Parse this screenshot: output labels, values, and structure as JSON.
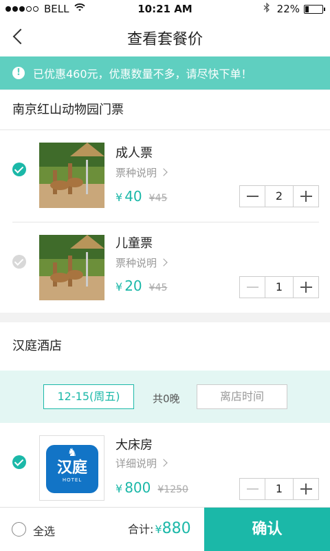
{
  "status_bar": {
    "carrier": "BELL",
    "time": "10:21 AM",
    "battery": "22%"
  },
  "nav": {
    "title": "查看套餐价"
  },
  "notice": {
    "text": "已优惠460元，优惠数量不多，请尽快下单！"
  },
  "ticket_section": {
    "title": "南京红山动物园门票",
    "items": [
      {
        "name": "成人票",
        "desc": "票种说明",
        "currency": "¥",
        "price": "40",
        "old_price": "¥45",
        "qty": "2",
        "checked": true
      },
      {
        "name": "儿童票",
        "desc": "票种说明",
        "currency": "¥",
        "price": "20",
        "old_price": "¥45",
        "qty": "1",
        "checked": false
      }
    ]
  },
  "hotel_section": {
    "title": "汉庭酒店",
    "checkin": "12-15(周五)",
    "nights": "共0晚",
    "checkout": "离店时间",
    "logo": {
      "cn": "汉庭",
      "en": "HOTEL"
    },
    "room": {
      "name": "大床房",
      "desc": "详细说明",
      "currency": "¥",
      "price": "800",
      "old_price": "¥1250",
      "qty": "1",
      "checked": true
    }
  },
  "bottom": {
    "select_all": "全选",
    "total_label": "合计:",
    "currency": "¥",
    "total": "880",
    "confirm": "确认"
  },
  "colors": {
    "accent": "#1bb8a8",
    "notice_bg": "#5fcfc0",
    "date_bar_bg": "#e3f6f3",
    "logo_blue": "#1274c6"
  }
}
